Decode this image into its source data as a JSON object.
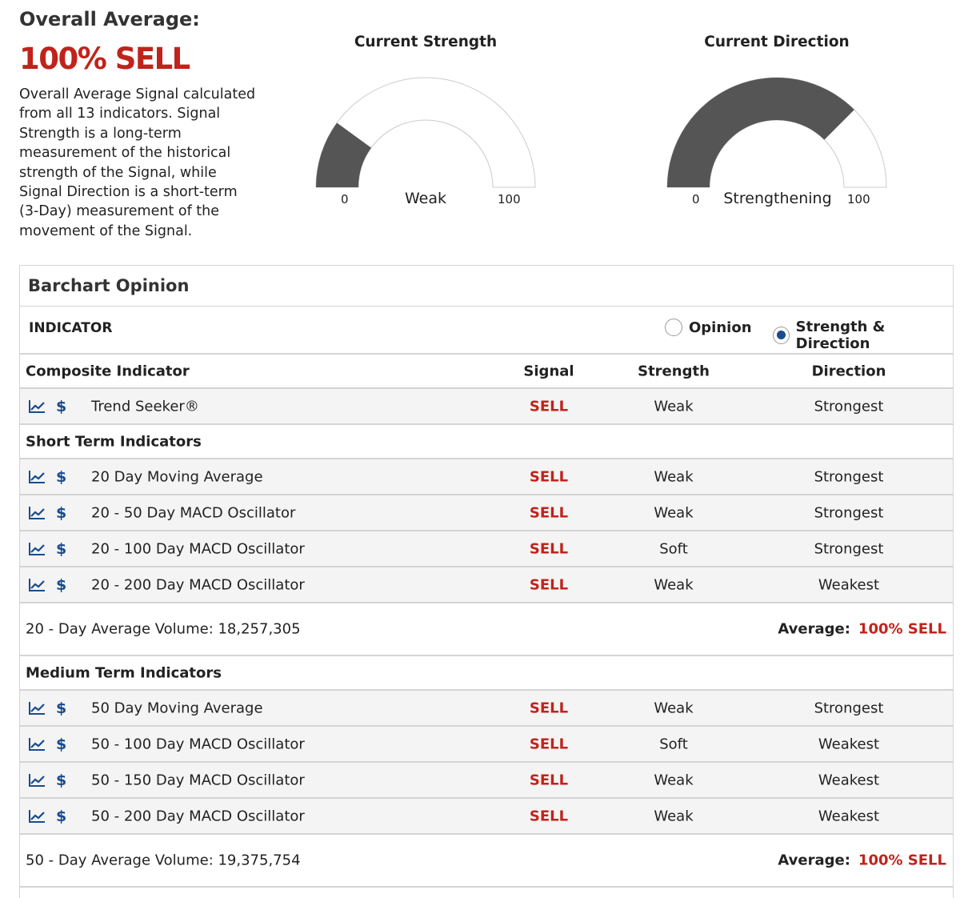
{
  "overall": {
    "heading": "Overall Average:",
    "big_value": "100% SELL",
    "description": "Overall Average Signal calculated from all 13 indicators. Signal Strength is a long-term measurement of the historical strength of the Signal, while Signal Direction is a short-term (3-Day) measurement of the movement of the Signal."
  },
  "gauges": {
    "strength": {
      "title": "Current Strength",
      "min_label": "0",
      "max_label": "100",
      "label": "Weak",
      "value_pct": 20
    },
    "direction": {
      "title": "Current Direction",
      "min_label": "0",
      "max_label": "100",
      "label": "Strengthening",
      "value_pct": 75
    },
    "fill_color": "#555555"
  },
  "panel": {
    "title": "Barchart Opinion",
    "indicator_label": "INDICATOR",
    "radio_opinion": "Opinion",
    "radio_strength": "Strength & Direction",
    "selected": "Strength & Direction"
  },
  "table": {
    "headers": {
      "name": "Composite Indicator",
      "signal": "Signal",
      "strength": "Strength",
      "direction": "Direction"
    },
    "composite": [
      {
        "name": "Trend Seeker®",
        "signal": "SELL",
        "strength": "Weak",
        "direction": "Strongest"
      }
    ],
    "short_term": {
      "title": "Short Term Indicators",
      "rows": [
        {
          "name": "20 Day Moving Average",
          "signal": "SELL",
          "strength": "Weak",
          "direction": "Strongest"
        },
        {
          "name": "20 - 50 Day MACD Oscillator",
          "signal": "SELL",
          "strength": "Weak",
          "direction": "Strongest"
        },
        {
          "name": "20 - 100 Day MACD Oscillator",
          "signal": "SELL",
          "strength": "Soft",
          "direction": "Strongest"
        },
        {
          "name": "20 - 200 Day MACD Oscillator",
          "signal": "SELL",
          "strength": "Weak",
          "direction": "Weakest"
        }
      ],
      "volume": "20 - Day Average Volume: 18,257,305",
      "average_label": "Average:",
      "average_value": "100% SELL"
    },
    "medium_term": {
      "title": "Medium Term Indicators",
      "rows": [
        {
          "name": "50 Day Moving Average",
          "signal": "SELL",
          "strength": "Weak",
          "direction": "Strongest"
        },
        {
          "name": "50 - 100 Day MACD Oscillator",
          "signal": "SELL",
          "strength": "Soft",
          "direction": "Weakest"
        },
        {
          "name": "50 - 150 Day MACD Oscillator",
          "signal": "SELL",
          "strength": "Weak",
          "direction": "Weakest"
        },
        {
          "name": "50 - 200 Day MACD Oscillator",
          "signal": "SELL",
          "strength": "Weak",
          "direction": "Weakest"
        }
      ],
      "volume": "50 - Day Average Volume: 19,375,754",
      "average_label": "Average:",
      "average_value": "100% SELL"
    },
    "icons": {
      "chart": "chart-icon",
      "dollar": "dollar-icon",
      "dollar_glyph": "$"
    }
  }
}
